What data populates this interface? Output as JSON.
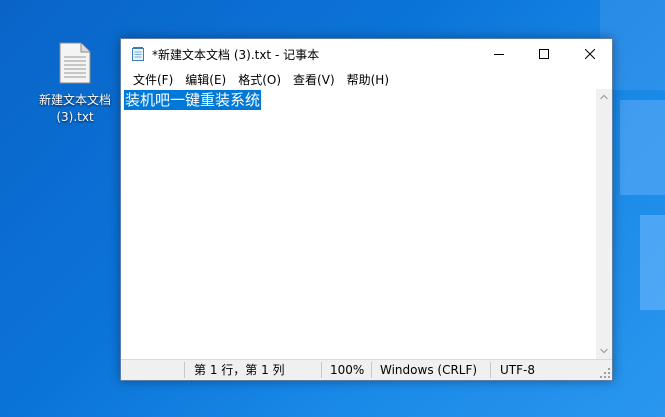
{
  "desktop": {
    "icon_label": "新建文本文档\n(3).txt",
    "icon_name": "text-file-icon"
  },
  "window": {
    "title": "*新建文本文档 (3).txt - 记事本",
    "menu": [
      {
        "label": "文件(F)"
      },
      {
        "label": "编辑(E)"
      },
      {
        "label": "格式(O)"
      },
      {
        "label": "查看(V)"
      },
      {
        "label": "帮助(H)"
      }
    ],
    "content_text": "装机吧一键重装系统",
    "selection_color": "#0078d7"
  },
  "status": {
    "position": "第 1 行，第 1 列",
    "zoom": "100%",
    "line_ending": "Windows (CRLF)",
    "encoding": "UTF-8"
  }
}
